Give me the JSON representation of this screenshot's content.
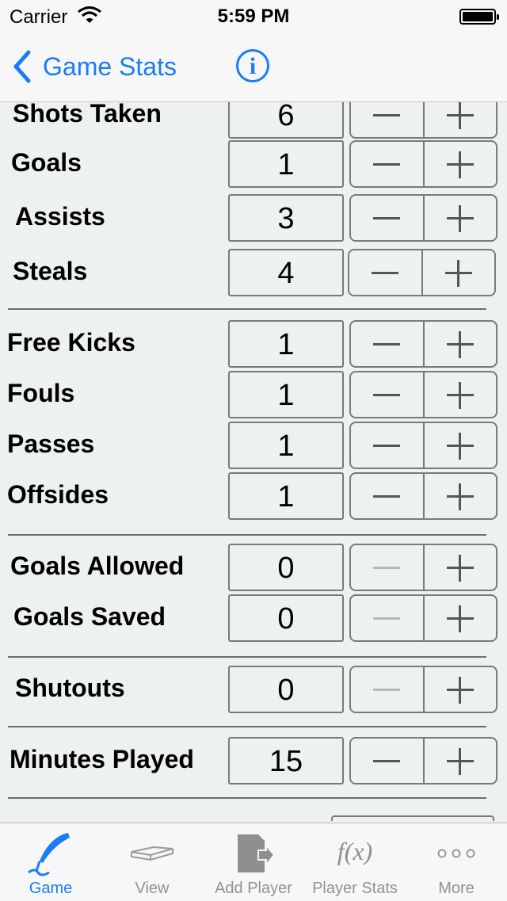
{
  "status_bar": {
    "carrier": "Carrier",
    "time": "5:59 PM"
  },
  "nav": {
    "back_label": "Game Stats",
    "info_glyph": "i"
  },
  "stats": [
    {
      "label": "Shots Taken",
      "value": "6",
      "minus_disabled": false
    },
    {
      "label": "Goals",
      "value": "1",
      "minus_disabled": false
    },
    {
      "label": "Assists",
      "value": "3",
      "minus_disabled": false
    },
    {
      "label": "Steals",
      "value": "4",
      "minus_disabled": false
    },
    {
      "label": "Free Kicks",
      "value": "1",
      "minus_disabled": false
    },
    {
      "label": "Fouls",
      "value": "1",
      "minus_disabled": false
    },
    {
      "label": "Passes",
      "value": "1",
      "minus_disabled": false
    },
    {
      "label": "Offsides",
      "value": "1",
      "minus_disabled": false
    },
    {
      "label": "Goals Allowed",
      "value": "0",
      "minus_disabled": true
    },
    {
      "label": "Goals Saved",
      "value": "0",
      "minus_disabled": true
    },
    {
      "label": "Shutouts",
      "value": "0",
      "minus_disabled": true
    },
    {
      "label": "Minutes Played",
      "value": "15",
      "minus_disabled": false
    }
  ],
  "tabs": [
    {
      "label": "Game",
      "icon": "quill-icon",
      "active": true
    },
    {
      "label": "View",
      "icon": "book-icon",
      "active": false
    },
    {
      "label": "Add Player",
      "icon": "add-player-icon",
      "active": false
    },
    {
      "label": "Player Stats",
      "icon": "function-icon",
      "active": false
    },
    {
      "label": "More",
      "icon": "more-icon",
      "active": false
    }
  ],
  "colors": {
    "accent": "#1a7cf6",
    "background": "#eef1f2",
    "border": "#7a7a7a"
  }
}
